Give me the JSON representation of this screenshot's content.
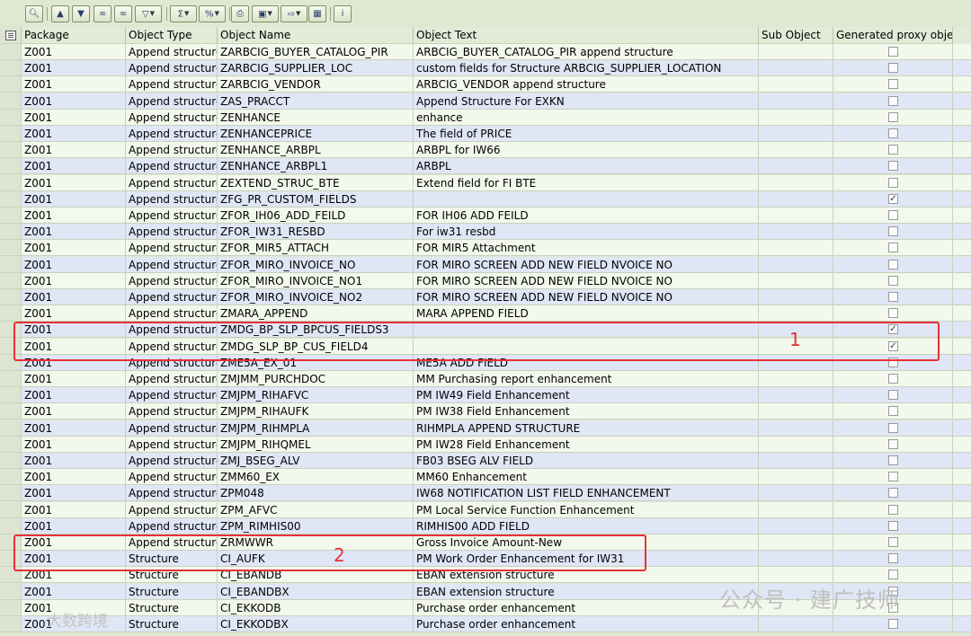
{
  "toolbar": {
    "buttons": [
      "details",
      "sort-ascending",
      "sort-descending",
      "find",
      "find-next",
      "filter",
      "sum",
      "subtotals",
      "export",
      "print-preview",
      "print",
      "layout",
      "views",
      "info"
    ]
  },
  "columns": {
    "package": "Package",
    "object_type": "Object Type",
    "object_name": "Object Name",
    "object_text": "Object Text",
    "sub_object": "Sub Object",
    "generated_proxy": "Generated proxy object"
  },
  "rows": [
    {
      "package": "Z001",
      "type": "Append structure",
      "name": "ZARBCIG_BUYER_CATALOG_PIR",
      "text": "ARBCIG_BUYER_CATALOG_PIR append structure",
      "sub": "",
      "proxy": false
    },
    {
      "package": "Z001",
      "type": "Append structure",
      "name": "ZARBCIG_SUPPLIER_LOC",
      "text": "custom fields for Structure ARBCIG_SUPPLIER_LOCATION",
      "sub": "",
      "proxy": false
    },
    {
      "package": "Z001",
      "type": "Append structure",
      "name": "ZARBCIG_VENDOR",
      "text": "ARBCIG_VENDOR append structure",
      "sub": "",
      "proxy": false
    },
    {
      "package": "Z001",
      "type": "Append structure",
      "name": "ZAS_PRACCT",
      "text": "Append Structure For EXKN",
      "sub": "",
      "proxy": false
    },
    {
      "package": "Z001",
      "type": "Append structure",
      "name": "ZENHANCE",
      "text": "enhance",
      "sub": "",
      "proxy": false
    },
    {
      "package": "Z001",
      "type": "Append structure",
      "name": "ZENHANCEPRICE",
      "text": "The field of PRICE",
      "sub": "",
      "proxy": false
    },
    {
      "package": "Z001",
      "type": "Append structure",
      "name": "ZENHANCE_ARBPL",
      "text": "ARBPL for IW66",
      "sub": "",
      "proxy": false
    },
    {
      "package": "Z001",
      "type": "Append structure",
      "name": "ZENHANCE_ARBPL1",
      "text": "ARBPL",
      "sub": "",
      "proxy": false
    },
    {
      "package": "Z001",
      "type": "Append structure",
      "name": "ZEXTEND_STRUC_BTE",
      "text": "Extend field for FI BTE",
      "sub": "",
      "proxy": false
    },
    {
      "package": "Z001",
      "type": "Append structure",
      "name": "ZFG_PR_CUSTOM_FIELDS",
      "text": "",
      "sub": "",
      "proxy": true
    },
    {
      "package": "Z001",
      "type": "Append structure",
      "name": "ZFOR_IH06_ADD_FEILD",
      "text": "FOR IH06 ADD FEILD",
      "sub": "",
      "proxy": false
    },
    {
      "package": "Z001",
      "type": "Append structure",
      "name": "ZFOR_IW31_RESBD",
      "text": "For iw31 resbd",
      "sub": "",
      "proxy": false
    },
    {
      "package": "Z001",
      "type": "Append structure",
      "name": "ZFOR_MIR5_ATTACH",
      "text": "FOR MIR5 Attachment",
      "sub": "",
      "proxy": false
    },
    {
      "package": "Z001",
      "type": "Append structure",
      "name": "ZFOR_MIRO_INVOICE_NO",
      "text": "FOR MIRO SCREEN ADD NEW FIELD NVOICE NO",
      "sub": "",
      "proxy": false
    },
    {
      "package": "Z001",
      "type": "Append structure",
      "name": "ZFOR_MIRO_INVOICE_NO1",
      "text": "FOR MIRO SCREEN ADD NEW FIELD NVOICE NO",
      "sub": "",
      "proxy": false
    },
    {
      "package": "Z001",
      "type": "Append structure",
      "name": "ZFOR_MIRO_INVOICE_NO2",
      "text": "FOR MIRO SCREEN ADD NEW FIELD NVOICE NO",
      "sub": "",
      "proxy": false
    },
    {
      "package": "Z001",
      "type": "Append structure",
      "name": "ZMARA_APPEND",
      "text": "MARA APPEND FIELD",
      "sub": "",
      "proxy": false
    },
    {
      "package": "Z001",
      "type": "Append structure",
      "name": "ZMDG_BP_SLP_BPCUS_FIELDS3",
      "text": "",
      "sub": "",
      "proxy": true
    },
    {
      "package": "Z001",
      "type": "Append structure",
      "name": "ZMDG_SLP_BP_CUS_FIELD4",
      "text": "",
      "sub": "",
      "proxy": true
    },
    {
      "package": "Z001",
      "type": "Append structure",
      "name": "ZME5A_EX_01",
      "text": "ME5A ADD FIELD",
      "sub": "",
      "proxy": false
    },
    {
      "package": "Z001",
      "type": "Append structure",
      "name": "ZMJMM_PURCHDOC",
      "text": "MM Purchasing report enhancement",
      "sub": "",
      "proxy": false
    },
    {
      "package": "Z001",
      "type": "Append structure",
      "name": "ZMJPM_RIHAFVC",
      "text": "PM IW49 Field Enhancement",
      "sub": "",
      "proxy": false
    },
    {
      "package": "Z001",
      "type": "Append structure",
      "name": "ZMJPM_RIHAUFK",
      "text": "PM IW38 Field Enhancement",
      "sub": "",
      "proxy": false
    },
    {
      "package": "Z001",
      "type": "Append structure",
      "name": "ZMJPM_RIHMPLA",
      "text": "RIHMPLA APPEND STRUCTURE",
      "sub": "",
      "proxy": false
    },
    {
      "package": "Z001",
      "type": "Append structure",
      "name": "ZMJPM_RIHQMEL",
      "text": "PM IW28 Field Enhancement",
      "sub": "",
      "proxy": false
    },
    {
      "package": "Z001",
      "type": "Append structure",
      "name": "ZMJ_BSEG_ALV",
      "text": "FB03 BSEG ALV FIELD",
      "sub": "",
      "proxy": false
    },
    {
      "package": "Z001",
      "type": "Append structure",
      "name": "ZMM60_EX",
      "text": "MM60 Enhancement",
      "sub": "",
      "proxy": false
    },
    {
      "package": "Z001",
      "type": "Append structure",
      "name": "ZPM048",
      "text": "IW68 NOTIFICATION LIST FIELD ENHANCEMENT",
      "sub": "",
      "proxy": false
    },
    {
      "package": "Z001",
      "type": "Append structure",
      "name": "ZPM_AFVC",
      "text": "PM Local Service Function Enhancement",
      "sub": "",
      "proxy": false
    },
    {
      "package": "Z001",
      "type": "Append structure",
      "name": "ZPM_RIMHIS00",
      "text": "RIMHIS00 ADD FIELD",
      "sub": "",
      "proxy": false
    },
    {
      "package": "Z001",
      "type": "Append structure",
      "name": "ZRMWWR",
      "text": "Gross Invoice Amount-New",
      "sub": "",
      "proxy": false
    },
    {
      "package": "Z001",
      "type": "Structure",
      "name": "CI_AUFK",
      "text": "PM Work Order Enhancement for IW31",
      "sub": "",
      "proxy": false
    },
    {
      "package": "Z001",
      "type": "Structure",
      "name": "CI_EBANDB",
      "text": "EBAN extension structure",
      "sub": "",
      "proxy": false
    },
    {
      "package": "Z001",
      "type": "Structure",
      "name": "CI_EBANDBX",
      "text": "EBAN extension structure",
      "sub": "",
      "proxy": false
    },
    {
      "package": "Z001",
      "type": "Structure",
      "name": "CI_EKKODB",
      "text": "Purchase order enhancement",
      "sub": "",
      "proxy": false
    },
    {
      "package": "Z001",
      "type": "Structure",
      "name": "CI_EKKODBX",
      "text": "Purchase order enhancement",
      "sub": "",
      "proxy": false
    }
  ],
  "annotations": {
    "box1_label": "1",
    "box2_label": "2",
    "color": "#e8303a"
  },
  "watermark": {
    "right": "公众号 · 建广技师",
    "left": "大数跨境"
  },
  "colors": {
    "row_even": "#f3f8ec",
    "row_odd": "#dfe6f5",
    "toolbar": "#dfe9d2"
  }
}
